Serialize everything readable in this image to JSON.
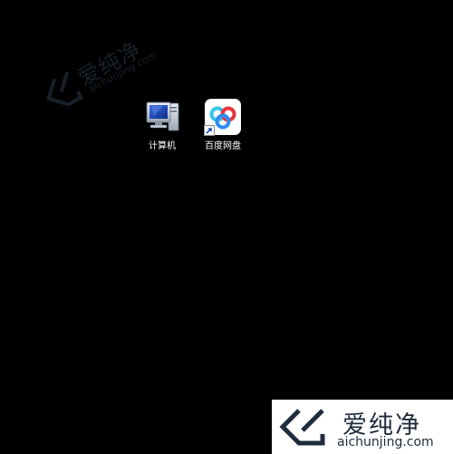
{
  "desktop": {
    "background": "#000000",
    "icons": [
      {
        "label": "计算机",
        "icon": "computer-icon"
      },
      {
        "label": "百度网盘",
        "icon": "baidu-netdisk-icon"
      }
    ]
  },
  "watermark": {
    "cn_text": "爱纯净",
    "en_text": "aichunjing.com",
    "color": "#1f2c3d"
  },
  "colors": {
    "baidu_blue": "#2f8cf0",
    "baidu_red": "#e8373d",
    "baidu_cyan": "#35c5e8"
  }
}
